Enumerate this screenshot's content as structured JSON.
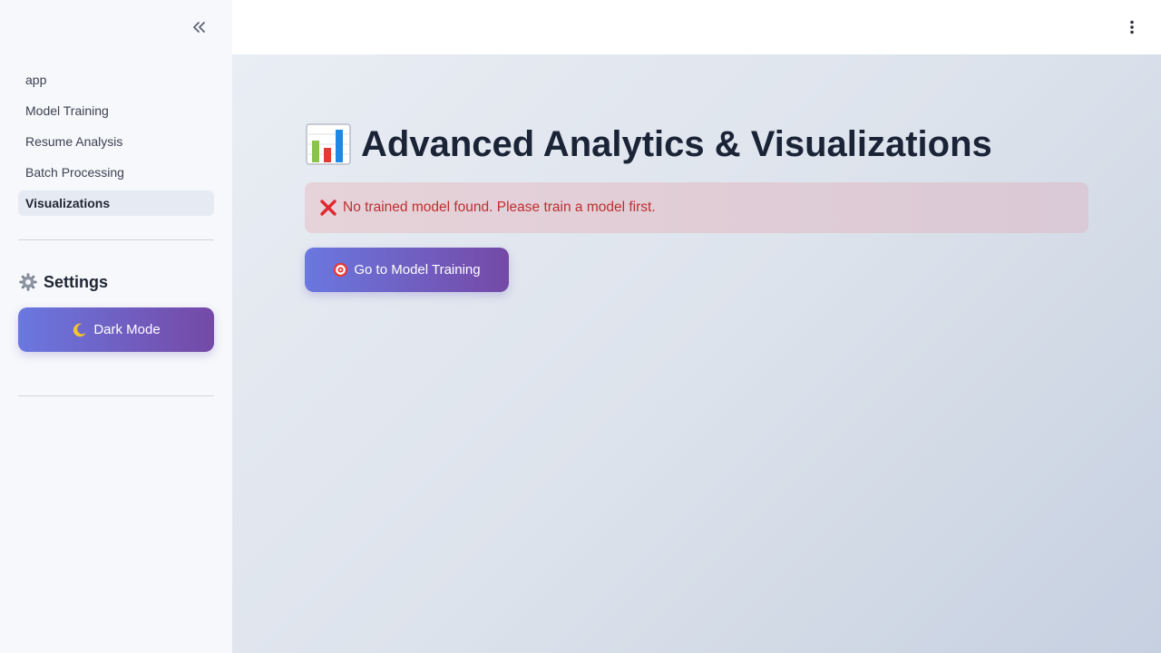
{
  "sidebar": {
    "nav_items": [
      {
        "label": "app",
        "active": false
      },
      {
        "label": "Model Training",
        "active": false
      },
      {
        "label": "Resume Analysis",
        "active": false
      },
      {
        "label": "Batch Processing",
        "active": false
      },
      {
        "label": "Visualizations",
        "active": true
      }
    ],
    "settings": {
      "icon": "gear-icon",
      "title": "Settings"
    },
    "dark_mode_button": {
      "icon": "moon-icon",
      "label": "Dark Mode"
    }
  },
  "main": {
    "title_icon": "bar-chart-icon",
    "title": "Advanced Analytics & Visualizations",
    "alert": {
      "icon": "cross-mark-icon",
      "text": "No trained model found. Please train a model first."
    },
    "go_button": {
      "icon": "target-icon",
      "label": "Go to Model Training"
    }
  },
  "colors": {
    "accent_start": "#6a78e0",
    "accent_end": "#7549a6",
    "error_text": "#bd2f2f",
    "sidebar_bg": "#f7f8fb"
  }
}
